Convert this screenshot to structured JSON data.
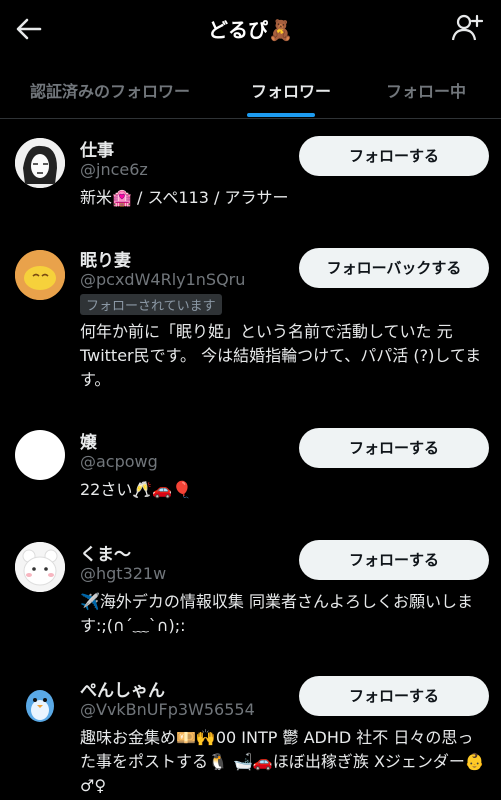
{
  "header": {
    "title": "どるぴ🧸",
    "back_icon": "back-arrow-icon",
    "add_icon": "add-person-icon"
  },
  "tabs": [
    {
      "label": "認証済みのフォロワー"
    },
    {
      "label": "フォロワー",
      "active": true
    },
    {
      "label": "フォロー中"
    }
  ],
  "users": [
    {
      "name": "仕事",
      "handle": "@jnce6z",
      "button": "フォローする",
      "bio": "新米🏩 / スペ113 / アラサー"
    },
    {
      "name": "眠り妻",
      "handle": "@pcxdW4Rly1nSQru",
      "button": "フォローバックする",
      "badge": "フォローされています",
      "bio": "何年か前に「眠り姫」という名前で活動していた 元Twitter民です。 今は結婚指輪つけて、パパ活 (?)してます。"
    },
    {
      "name": "嬢",
      "handle": "@acpowg",
      "button": "フォローする",
      "bio": "22さい🥂🚗🎈"
    },
    {
      "name": "くま〜",
      "handle": "@hgt321w",
      "button": "フォローする",
      "bio": "✈️海外デカの情報収集 同業者さんよろしくお願いします:;(∩´﹏`∩);:"
    },
    {
      "name": "ぺんしゃん",
      "handle": "@VvkBnUFp3W56554",
      "button": "フォローする",
      "bio": "趣味お金集め💴🙌00 INTP 鬱 ADHD 社不 日々の思った事をポストする🐧 🛁🚗ほぼ出稼ぎ族 Xジェンダー👶♂♀"
    }
  ],
  "colors": {
    "accent": "#1d9bf0",
    "background": "#000000",
    "button": "#eff3f4"
  }
}
